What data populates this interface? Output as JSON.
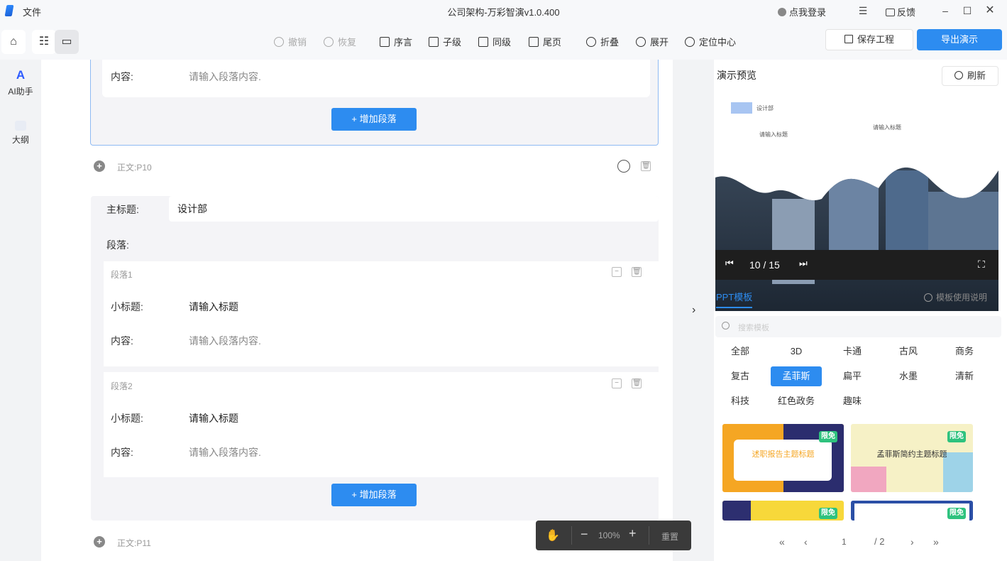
{
  "window": {
    "menu_file": "文件",
    "title": "公司架构-万彩智演v1.0.400",
    "login": "点我登录",
    "feedback": "反馈"
  },
  "toolbar": {
    "undo": "撤销",
    "redo": "恢复",
    "preface": "序言",
    "child": "子级",
    "sibling": "同级",
    "ending": "尾页",
    "collapse": "折叠",
    "expand": "展开",
    "locate": "定位中心",
    "save": "保存工程",
    "export": "导出演示"
  },
  "rail": {
    "ai": "AI助手",
    "outline": "大纲"
  },
  "editor": {
    "content_label": "内容:",
    "content_placeholder": "请输入段落内容.",
    "add_paragraph": "增加段落",
    "section_p10": "正文:P10",
    "main_title_label": "主标题:",
    "main_title_value": "设计部",
    "paragraphs_label": "段落:",
    "paragraph1": "段落1",
    "paragraph2": "段落2",
    "subtitle_label": "小标题:",
    "subtitle_placeholder": "请输入标题",
    "section_p11": "正文:P11"
  },
  "preview": {
    "title": "演示预览",
    "refresh": "刷新",
    "slide_tag": "设计部",
    "slide_sub1": "请输入标题",
    "slide_sub2": "请输入标题",
    "counter": "10 / 15"
  },
  "templates": {
    "tab": "PPT模板",
    "help": "模板使用说明",
    "search_placeholder": "搜索模板",
    "categories": [
      "全部",
      "3D",
      "卡通",
      "古风",
      "商务",
      "复古",
      "孟菲斯",
      "扁平",
      "水墨",
      "清新",
      "科技",
      "红色政务",
      "趣味"
    ],
    "selected": "孟菲斯",
    "badge": "限免",
    "thumb1_title": "述职报告主题标题",
    "thumb2_title": "孟菲斯简约主题标题",
    "page_current": "1",
    "page_total": "/ 2"
  },
  "zoom": {
    "value": "100%",
    "reset": "重置"
  },
  "colors": {
    "accent": "#2d8cf0",
    "badge": "#2ec27e"
  }
}
